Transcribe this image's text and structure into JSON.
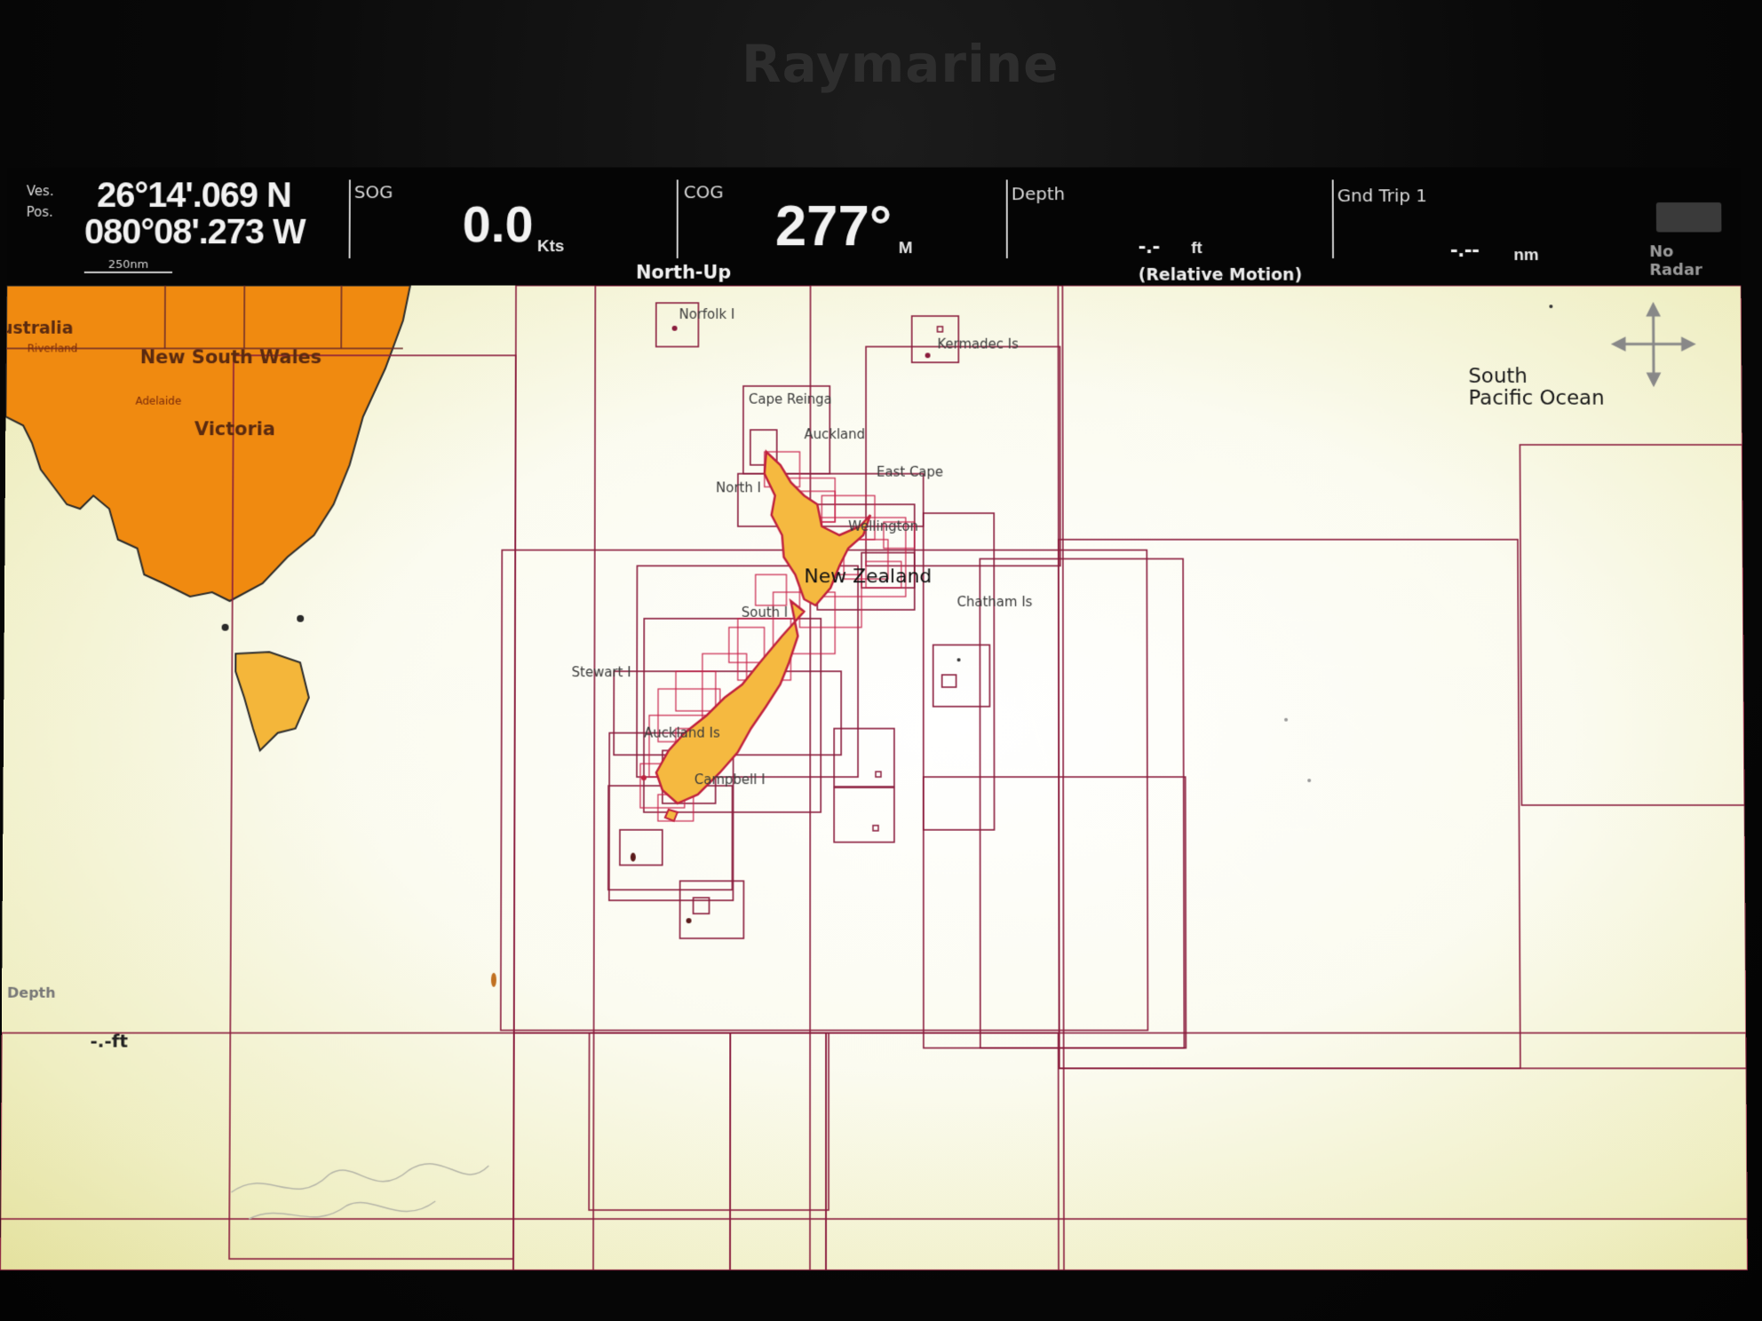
{
  "device": {
    "brand": "Raymarine"
  },
  "databar": {
    "position": {
      "label_top": "Ves.",
      "label_bottom": "Pos.",
      "lat": "26°14'.069 N",
      "lon": "080°08'.273 W",
      "scale": "250nm"
    },
    "sog": {
      "label": "SOG",
      "value": "0.0",
      "unit": "Kts"
    },
    "orientation": "North-Up",
    "cog": {
      "label": "COG",
      "value": "277°",
      "unit": "M"
    },
    "depth": {
      "label": "Depth",
      "value": "-.- ",
      "unit": "ft",
      "mode": "(Relative Motion)"
    },
    "trip": {
      "label": "Gnd Trip 1",
      "value": "-.--",
      "unit": "nm"
    },
    "radar": {
      "label": "No Radar"
    }
  },
  "map": {
    "land_labels": {
      "australia": "ustralia",
      "nsw": "New South Wales",
      "victoria": "Victoria",
      "adelaide": "Adelaide",
      "riverland": "Riverland"
    },
    "ocean_label_1": "South",
    "ocean_label_2": "Pacific Ocean",
    "country_label": "New Zealand",
    "places": {
      "norfolk": "Norfolk I",
      "kermadec": "Kermadec Is",
      "cape_reinga": "Cape Reinga",
      "auckland": "Auckland",
      "east_cape": "East Cape",
      "north_i": "North I",
      "wellington": "Wellington",
      "chatham": "Chatham Is",
      "south_i": "South I",
      "stewart": "Stewart I",
      "auckland_is": "Auckland Is",
      "campbell": "Campbell I"
    },
    "depth_overlay": {
      "label": "Depth",
      "value": "-.-ft"
    },
    "colors": {
      "land_orange": "#f08a10",
      "land_yellow": "#f4b63a",
      "nz_fill": "#f5b940",
      "chart_border": "#8a1c3c",
      "sea": "#fdfdf4"
    }
  }
}
